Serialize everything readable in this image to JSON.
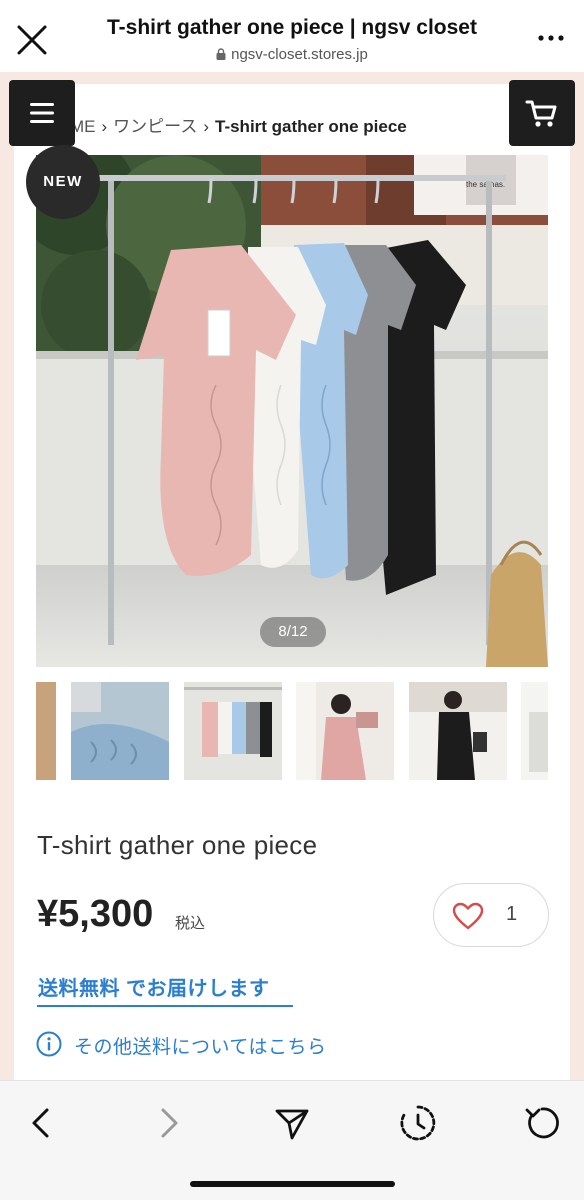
{
  "browser": {
    "title": "T-shirt gather one piece | ngsv closet",
    "url": "ngsv-closet.stores.jp"
  },
  "breadcrumb": {
    "home": "ME",
    "category": "ワンピース",
    "current": "T-shirt gather one piece"
  },
  "gallery": {
    "badge": "NEW",
    "counter": "8/12",
    "hanger_tag_text": "the samas."
  },
  "product": {
    "name": "T-shirt gather one piece",
    "price": "¥5,300",
    "tax_label": "税込",
    "like_count": "1"
  },
  "shipping": {
    "free_label": "送料無料 でお届けします",
    "other_link": "その他送料についてはこちら"
  },
  "colors": {
    "accent_blue": "#2b7ed0",
    "heart_red": "#d94a4a",
    "frame_pink": "#f8e8e2",
    "button_dark": "#1e1e1e"
  },
  "icons": {
    "close": "close-icon",
    "more": "more-icon",
    "lock": "lock-icon",
    "menu": "menu-icon",
    "cart": "cart-icon",
    "heart": "heart-icon",
    "info": "info-icon",
    "back": "back-icon",
    "forward": "forward-icon",
    "share": "share-icon",
    "history": "history-icon",
    "reload": "reload-icon"
  }
}
